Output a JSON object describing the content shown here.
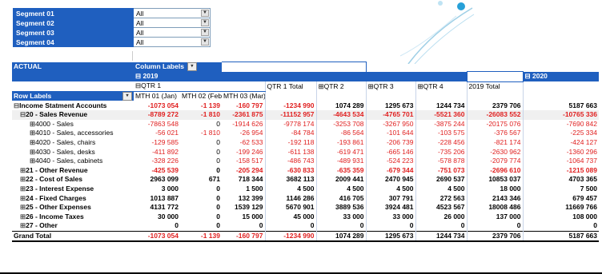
{
  "filters": [
    {
      "label": "Segment 01",
      "value": "All"
    },
    {
      "label": "Segment 02",
      "value": "All"
    },
    {
      "label": "Segment 03",
      "value": "All"
    },
    {
      "label": "Segment 04",
      "value": "All"
    }
  ],
  "icons": {
    "dropdown": "dropdown-arrow-icon",
    "filter": "filter-icon",
    "expand": "expand-icon",
    "collapse": "collapse-icon"
  },
  "pivot": {
    "actual": "ACTUAL",
    "column_labels": "Column Labels",
    "year_2019": "2019",
    "year_2020": "2020",
    "qtr1": "QTR 1",
    "qtr1_total": "QTR 1 Total",
    "qtr2": "QTR 2",
    "qtr3": "QTR 3",
    "qtr4": "QTR 4",
    "total_2019": "2019 Total",
    "row_labels": "Row Labels",
    "mth01": "MTH 01 (Jan)",
    "mth02": "MTH 02 (Feb)",
    "mth03": "MTH 03 (Mar)",
    "rows": [
      {
        "label": "Income Statment Accounts",
        "level": 1,
        "pm": "⊟",
        "bold": true,
        "v": [
          "-1073 054",
          "-1 139",
          "-160 797",
          "-1234 990",
          "1074 289",
          "1295 673",
          "1244 734",
          "2379 706",
          "5187 663"
        ]
      },
      {
        "label": "20 - Sales Revenue",
        "level": 2,
        "pm": "⊟",
        "bold": true,
        "shade": true,
        "v": [
          "-8789 272",
          "-1 810",
          "-2361 875",
          "-11152 957",
          "-4643 534",
          "-4765 701",
          "-5521 360",
          "-26083 552",
          "-10765 336"
        ]
      },
      {
        "label": "4000 - Sales",
        "level": 3,
        "pm": "⊞",
        "bold": false,
        "v": [
          "-7863 548",
          "0",
          "-1914 626",
          "-9778 174",
          "-3253 708",
          "-3267 950",
          "-3875 244",
          "-20175 076",
          "-7690 842"
        ]
      },
      {
        "label": "4010 - Sales, accessories",
        "level": 3,
        "pm": "⊞",
        "bold": false,
        "v": [
          "-56 021",
          "-1 810",
          "-26 954",
          "-84 784",
          "-86 564",
          "-101 644",
          "-103 575",
          "-376 567",
          "-225 334"
        ]
      },
      {
        "label": "4020 - Sales, chairs",
        "level": 3,
        "pm": "⊞",
        "bold": false,
        "v": [
          "-129 585",
          "0",
          "-62 533",
          "-192 118",
          "-193 861",
          "-206 739",
          "-228 456",
          "-821 174",
          "-424 127"
        ]
      },
      {
        "label": "4030 - Sales, desks",
        "level": 3,
        "pm": "⊞",
        "bold": false,
        "v": [
          "-411 892",
          "0",
          "-199 246",
          "-611 138",
          "-619 471",
          "-665 146",
          "-735 206",
          "-2630 962",
          "-1360 296"
        ]
      },
      {
        "label": "4040 - Sales, cabinets",
        "level": 3,
        "pm": "⊞",
        "bold": false,
        "v": [
          "-328 226",
          "0",
          "-158 517",
          "-486 743",
          "-489 931",
          "-524 223",
          "-578 878",
          "-2079 774",
          "-1064 737"
        ]
      },
      {
        "label": "21 - Other Revenue",
        "level": 2,
        "pm": "⊞",
        "bold": true,
        "v": [
          "-425 539",
          "0",
          "-205 294",
          "-630 833",
          "-635 359",
          "-679 344",
          "-751 073",
          "-2696 610",
          "-1215 089"
        ]
      },
      {
        "label": "22 - Cost of Sales",
        "level": 2,
        "pm": "⊞",
        "bold": true,
        "v": [
          "2963 099",
          "671",
          "718 344",
          "3682 113",
          "2009 441",
          "2470 945",
          "2690 537",
          "10853 037",
          "4703 365"
        ]
      },
      {
        "label": "23 - Interest Expense",
        "level": 2,
        "pm": "⊞",
        "bold": true,
        "v": [
          "3 000",
          "0",
          "1 500",
          "4 500",
          "4 500",
          "4 500",
          "4 500",
          "18 000",
          "7 500"
        ]
      },
      {
        "label": "24 - Fixed Charges",
        "level": 2,
        "pm": "⊞",
        "bold": true,
        "v": [
          "1013 887",
          "0",
          "132 399",
          "1146 286",
          "416 705",
          "307 791",
          "272 563",
          "2143 346",
          "679 457"
        ]
      },
      {
        "label": "25 - Other Expenses",
        "level": 2,
        "pm": "⊞",
        "bold": true,
        "v": [
          "4131 772",
          "0",
          "1539 129",
          "5670 901",
          "3889 536",
          "3924 481",
          "4523 567",
          "18008 486",
          "11669 766"
        ]
      },
      {
        "label": "26 - Income Taxes",
        "level": 2,
        "pm": "⊞",
        "bold": true,
        "v": [
          "30 000",
          "0",
          "15 000",
          "45 000",
          "33 000",
          "33 000",
          "26 000",
          "137 000",
          "108 000"
        ]
      },
      {
        "label": "27 - Other",
        "level": 2,
        "pm": "⊞",
        "bold": true,
        "v": [
          "0",
          "0",
          "0",
          "0",
          "0",
          "0",
          "0",
          "0",
          "0"
        ]
      }
    ],
    "grand": {
      "label": "Grand Total",
      "v": [
        "-1073 054",
        "-1 139",
        "-160 797",
        "-1234 990",
        "1074 289",
        "1295 673",
        "1244 734",
        "2379 706",
        "5187 663"
      ]
    }
  },
  "colors": {
    "header_blue": "#1f5fbf",
    "negative_red": "#e02020"
  }
}
